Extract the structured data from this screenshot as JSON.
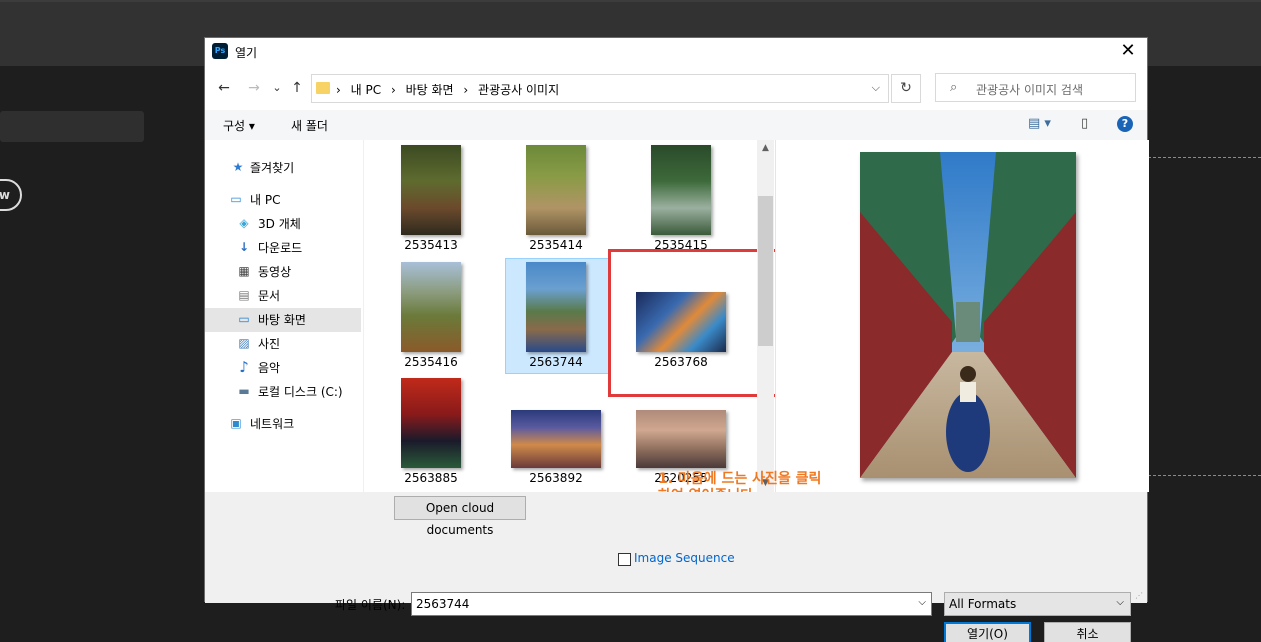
{
  "background": {
    "badge_text": "w"
  },
  "dialog": {
    "title": "열기",
    "app_icon": "Ps",
    "close_glyph": "✕",
    "nav": {
      "back": "←",
      "forward": "→",
      "recent": "⌄",
      "up": "↑"
    },
    "breadcrumb": [
      "내 PC",
      "바탕 화면",
      "관광공사 이미지"
    ],
    "breadcrumb_sep": "›",
    "refresh_glyph": "↻",
    "search_placeholder": "관광공사 이미지 검색",
    "toolbar": {
      "organize": "구성 ▾",
      "new_folder": "새 폴더",
      "view_glyph": "▤ ▾",
      "pane_glyph": "▯",
      "help": "?"
    },
    "sidebar": [
      {
        "label": "즐겨찾기",
        "icon": "star-icon",
        "glyph": "★"
      },
      {
        "label": "내 PC",
        "icon": "pc-icon",
        "glyph": "▭"
      },
      {
        "label": "3D 개체",
        "icon": "cube-icon",
        "glyph": "◈"
      },
      {
        "label": "다운로드",
        "icon": "download-icon",
        "glyph": "↓"
      },
      {
        "label": "동영상",
        "icon": "video-icon",
        "glyph": "▦"
      },
      {
        "label": "문서",
        "icon": "document-icon",
        "glyph": "▤"
      },
      {
        "label": "바탕 화면",
        "icon": "desktop-icon",
        "glyph": "▭"
      },
      {
        "label": "사진",
        "icon": "picture-icon",
        "glyph": "▨"
      },
      {
        "label": "음악",
        "icon": "music-icon",
        "glyph": "♪"
      },
      {
        "label": "로컬 디스크 (C:)",
        "icon": "disk-icon",
        "glyph": "▬"
      },
      {
        "label": "네트워크",
        "icon": "network-icon",
        "glyph": "▣"
      }
    ],
    "files": [
      {
        "name": "2535413"
      },
      {
        "name": "2535414"
      },
      {
        "name": "2535415"
      },
      {
        "name": "2535416"
      },
      {
        "name": "2563744"
      },
      {
        "name": "2563768"
      },
      {
        "name": "2563885"
      },
      {
        "name": "2563892"
      },
      {
        "name": "2620255"
      }
    ],
    "selected_file": "2563744",
    "annotation": [
      "1. 마음에 드는 사진을 클릭",
      "하여 열어줍니다."
    ],
    "scroll_up": "▲",
    "scroll_down": "▼",
    "open_cloud": "Open cloud documents",
    "image_sequence": "Image Sequence",
    "filename_label": "파일 이름(N):",
    "filename_value": "2563744",
    "format_value": "All Formats",
    "dropdown_glyph": "⌵",
    "open_button": "열기(O)",
    "cancel_button": "취소"
  }
}
